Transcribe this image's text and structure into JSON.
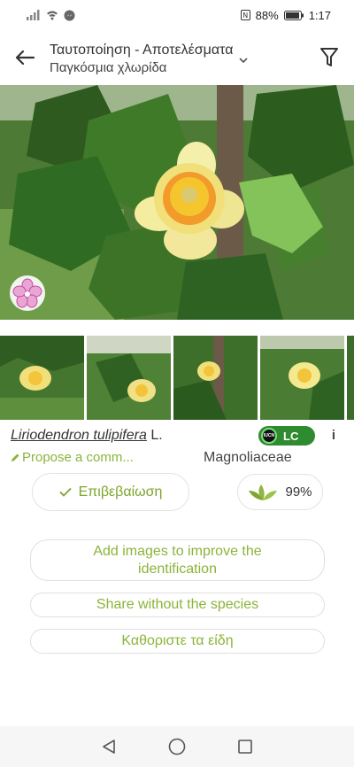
{
  "status_bar": {
    "battery": "88%",
    "time": "1:17"
  },
  "app_bar": {
    "title": "Ταυτοποίηση - Αποτελέσματα",
    "subtitle": "Παγκόσμια χλωρίδα",
    "icons": {
      "back": "back-arrow-icon",
      "dropdown": "chevron-down-icon",
      "filter": "filter-icon"
    }
  },
  "result": {
    "species_name": "Liriodendron tulipifera",
    "species_author": "L.",
    "iucn_status": "LC",
    "iucn_label": "IUCN",
    "info_glyph": "i",
    "propose_common_name": "Propose a comm...",
    "family": "Magnoliaceae",
    "confirm_label": "Επιβεβαίωση",
    "score": "99%"
  },
  "actions": {
    "add_images": "Add images to improve the identification",
    "share_without_species": "Share without the species",
    "define_species": "Καθοριστε τα είδη"
  },
  "colors": {
    "accent_green": "#8bb43a",
    "iucn_green": "#2f8b2f",
    "text_dark": "#333333"
  }
}
